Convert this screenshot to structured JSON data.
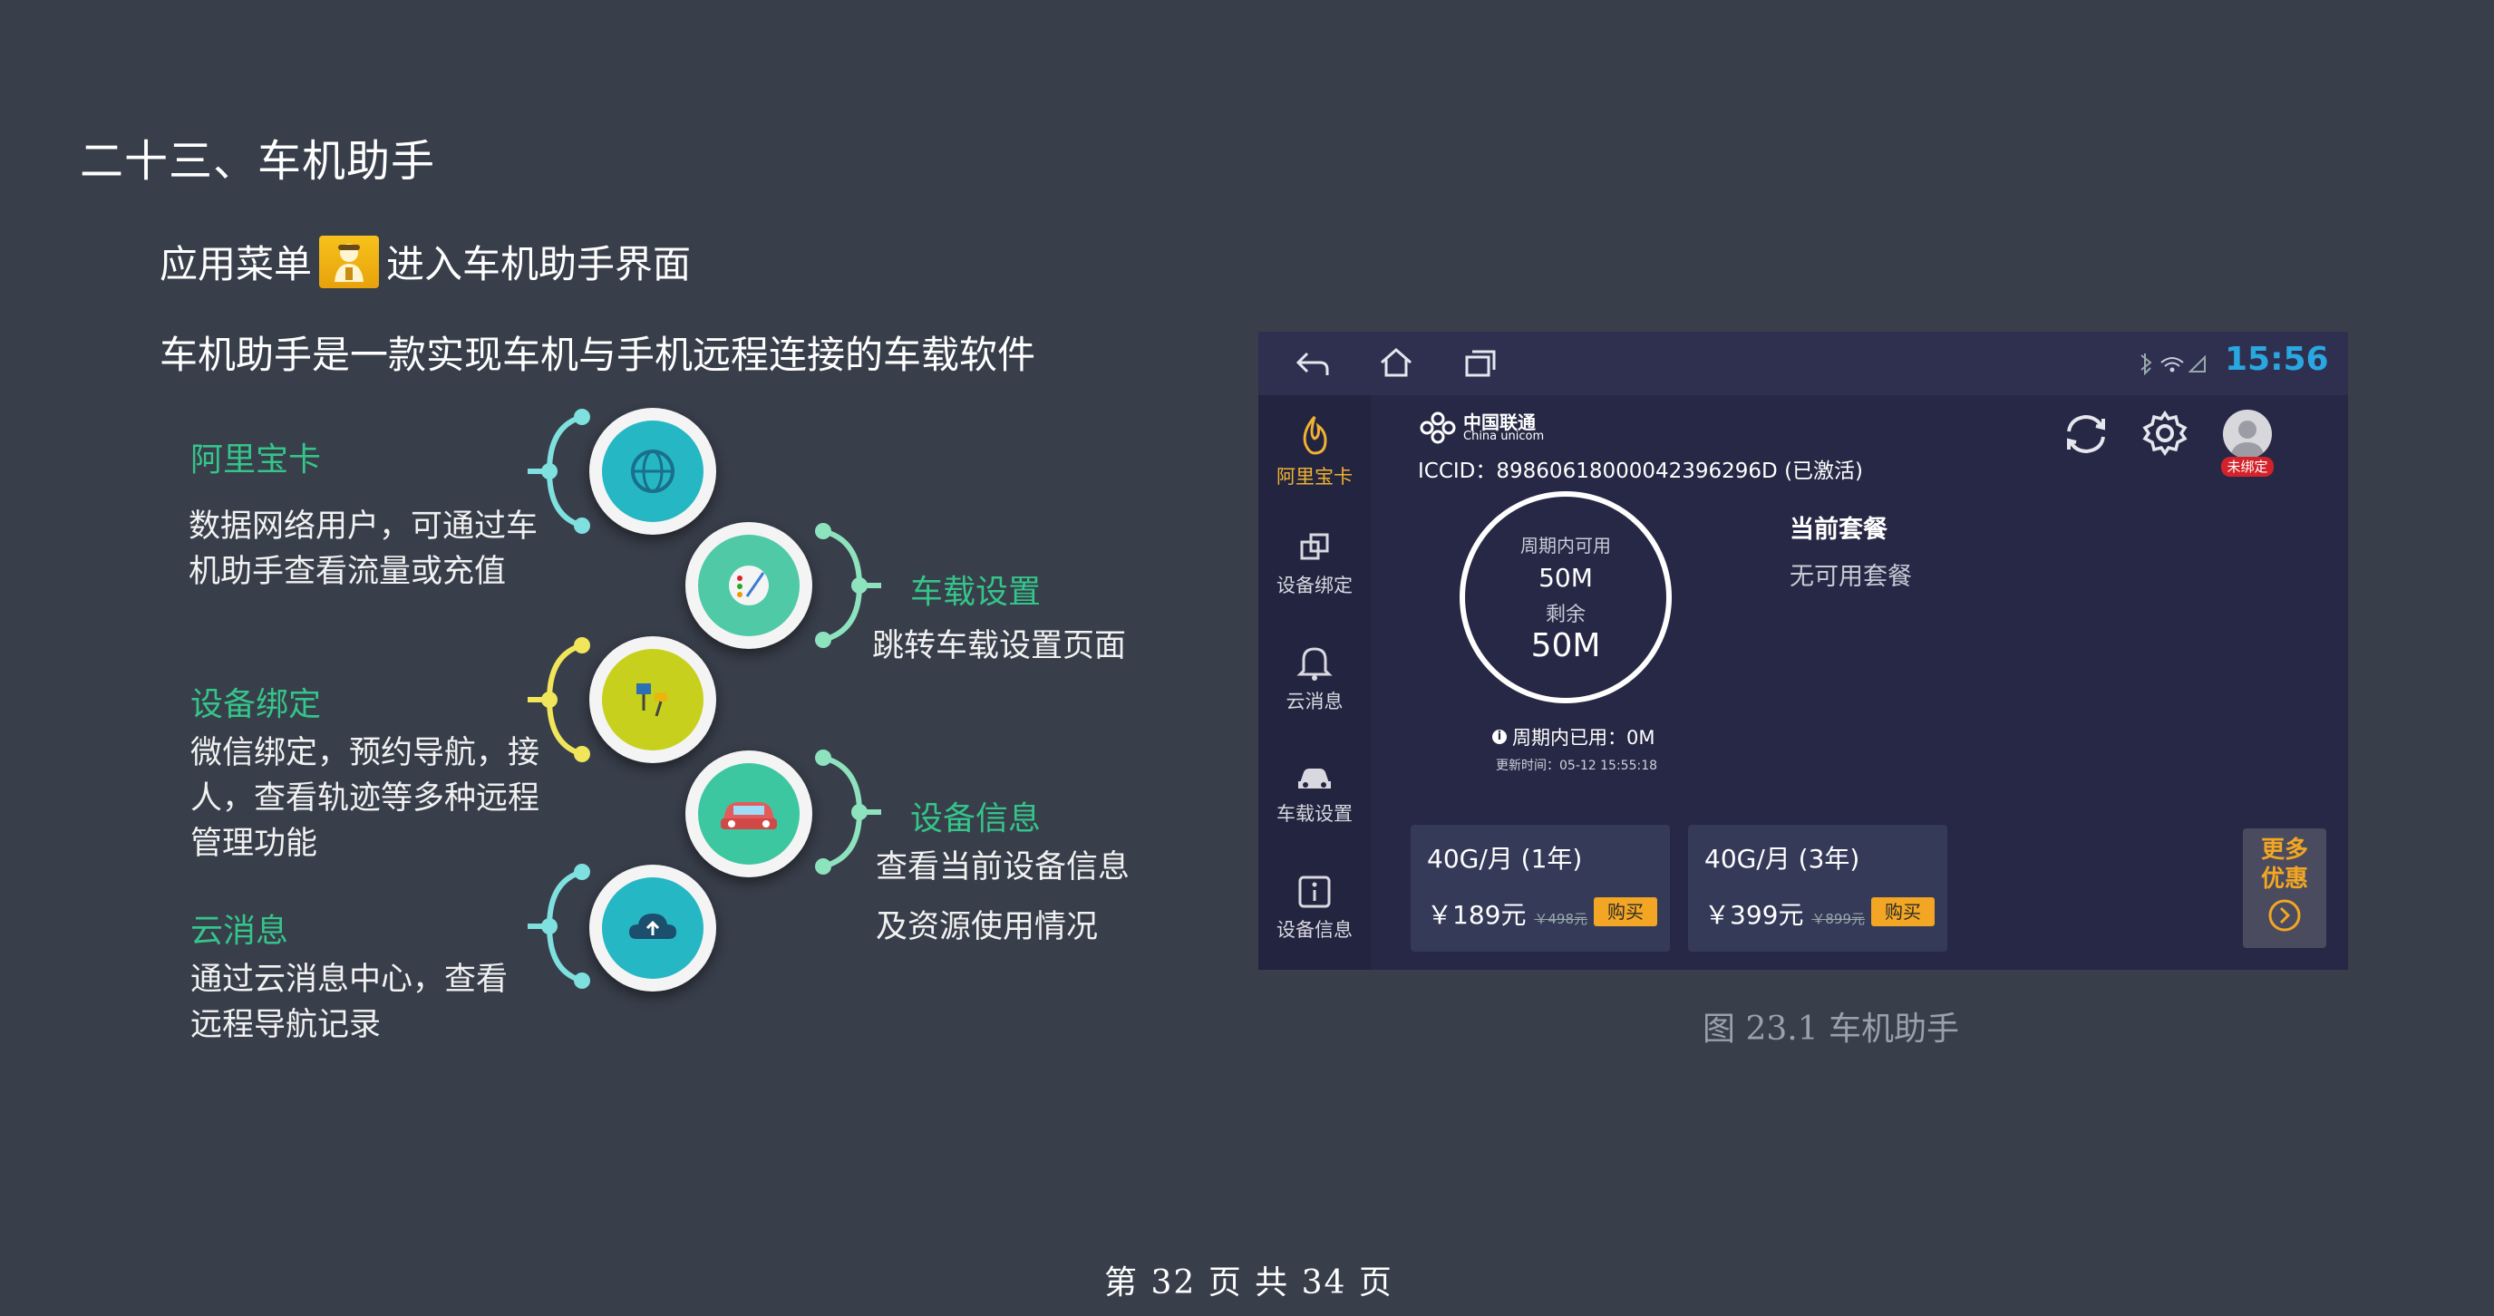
{
  "heading": "二十三、车机助手",
  "intro": {
    "before_icon": "应用菜单",
    "after_icon": "进入车机助手界面",
    "description": "车机助手是一款实现车机与手机远程连接的车载软件"
  },
  "features": {
    "alipay_card": {
      "title": "阿里宝卡",
      "desc_line1": "数据网络用户，可通过车",
      "desc_line2": "机助手查看流量或充值",
      "color": "#26b7c5"
    },
    "car_settings": {
      "title": "车载设置",
      "desc_line1": "跳转车载设置页面",
      "color": "#4fc9a6"
    },
    "device_binding": {
      "title": "设备绑定",
      "desc_line1": "微信绑定，预约导航，接",
      "desc_line2": "人，查看轨迹等多种远程",
      "desc_line3": "管理功能",
      "color": "#c7d11d"
    },
    "device_info": {
      "title": "设备信息",
      "desc_line1": "查看当前设备信息",
      "desc_line2": "及资源使用情况",
      "color": "#3cc7a0"
    },
    "cloud_msg": {
      "title": "云消息",
      "desc_line1": "通过云消息中心，查看",
      "desc_line2": "远程导航记录",
      "color": "#26b7c5"
    }
  },
  "screen": {
    "time": "15:56",
    "sidebar": [
      "阿里宝卡",
      "设备绑定",
      "云消息",
      "车载设置",
      "设备信息"
    ],
    "carrier_cn": "中国联通",
    "carrier_en": "China unicom",
    "iccid": "ICCID：89860618000042396296D (已激活)",
    "ring": {
      "available_label": "周期内可用",
      "available_value": "50M",
      "remaining_label": "剩余",
      "remaining_value": "50M"
    },
    "used": "周期内已用：0M",
    "updated": "更新时间：05-12  15:55:18",
    "plan_title": "当前套餐",
    "plan_value": "无可用套餐",
    "unbound": "未绑定",
    "packages": [
      {
        "name": "40G/月  (1年)",
        "price": "￥189元",
        "orig": "￥498元",
        "buy": "购买"
      },
      {
        "name": "40G/月  (3年)",
        "price": "￥399元",
        "orig": "￥899元",
        "buy": "购买"
      }
    ],
    "more_line1": "更多",
    "more_line2": "优惠",
    "accent": "#29a7e0"
  },
  "caption": "图 23.1  车机助手",
  "footer": "第  32  页  共  34  页"
}
